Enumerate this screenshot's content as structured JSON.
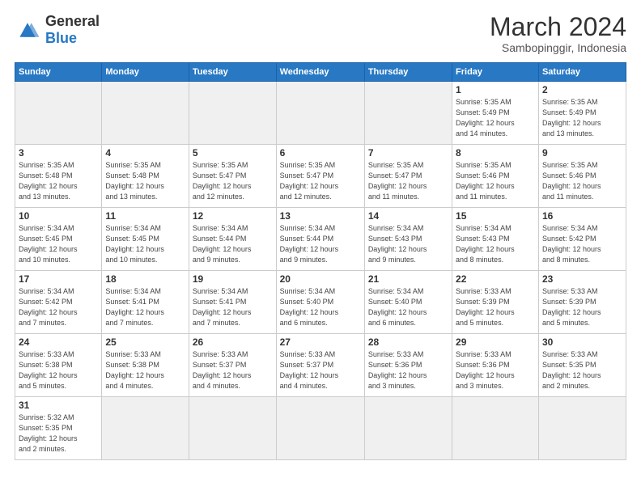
{
  "header": {
    "logo_general": "General",
    "logo_blue": "Blue",
    "month_year": "March 2024",
    "location": "Sambopinggir, Indonesia"
  },
  "weekdays": [
    "Sunday",
    "Monday",
    "Tuesday",
    "Wednesday",
    "Thursday",
    "Friday",
    "Saturday"
  ],
  "weeks": [
    [
      {
        "day": "",
        "info": ""
      },
      {
        "day": "",
        "info": ""
      },
      {
        "day": "",
        "info": ""
      },
      {
        "day": "",
        "info": ""
      },
      {
        "day": "",
        "info": ""
      },
      {
        "day": "1",
        "info": "Sunrise: 5:35 AM\nSunset: 5:49 PM\nDaylight: 12 hours\nand 14 minutes."
      },
      {
        "day": "2",
        "info": "Sunrise: 5:35 AM\nSunset: 5:49 PM\nDaylight: 12 hours\nand 13 minutes."
      }
    ],
    [
      {
        "day": "3",
        "info": "Sunrise: 5:35 AM\nSunset: 5:48 PM\nDaylight: 12 hours\nand 13 minutes."
      },
      {
        "day": "4",
        "info": "Sunrise: 5:35 AM\nSunset: 5:48 PM\nDaylight: 12 hours\nand 13 minutes."
      },
      {
        "day": "5",
        "info": "Sunrise: 5:35 AM\nSunset: 5:47 PM\nDaylight: 12 hours\nand 12 minutes."
      },
      {
        "day": "6",
        "info": "Sunrise: 5:35 AM\nSunset: 5:47 PM\nDaylight: 12 hours\nand 12 minutes."
      },
      {
        "day": "7",
        "info": "Sunrise: 5:35 AM\nSunset: 5:47 PM\nDaylight: 12 hours\nand 11 minutes."
      },
      {
        "day": "8",
        "info": "Sunrise: 5:35 AM\nSunset: 5:46 PM\nDaylight: 12 hours\nand 11 minutes."
      },
      {
        "day": "9",
        "info": "Sunrise: 5:35 AM\nSunset: 5:46 PM\nDaylight: 12 hours\nand 11 minutes."
      }
    ],
    [
      {
        "day": "10",
        "info": "Sunrise: 5:34 AM\nSunset: 5:45 PM\nDaylight: 12 hours\nand 10 minutes."
      },
      {
        "day": "11",
        "info": "Sunrise: 5:34 AM\nSunset: 5:45 PM\nDaylight: 12 hours\nand 10 minutes."
      },
      {
        "day": "12",
        "info": "Sunrise: 5:34 AM\nSunset: 5:44 PM\nDaylight: 12 hours\nand 9 minutes."
      },
      {
        "day": "13",
        "info": "Sunrise: 5:34 AM\nSunset: 5:44 PM\nDaylight: 12 hours\nand 9 minutes."
      },
      {
        "day": "14",
        "info": "Sunrise: 5:34 AM\nSunset: 5:43 PM\nDaylight: 12 hours\nand 9 minutes."
      },
      {
        "day": "15",
        "info": "Sunrise: 5:34 AM\nSunset: 5:43 PM\nDaylight: 12 hours\nand 8 minutes."
      },
      {
        "day": "16",
        "info": "Sunrise: 5:34 AM\nSunset: 5:42 PM\nDaylight: 12 hours\nand 8 minutes."
      }
    ],
    [
      {
        "day": "17",
        "info": "Sunrise: 5:34 AM\nSunset: 5:42 PM\nDaylight: 12 hours\nand 7 minutes."
      },
      {
        "day": "18",
        "info": "Sunrise: 5:34 AM\nSunset: 5:41 PM\nDaylight: 12 hours\nand 7 minutes."
      },
      {
        "day": "19",
        "info": "Sunrise: 5:34 AM\nSunset: 5:41 PM\nDaylight: 12 hours\nand 7 minutes."
      },
      {
        "day": "20",
        "info": "Sunrise: 5:34 AM\nSunset: 5:40 PM\nDaylight: 12 hours\nand 6 minutes."
      },
      {
        "day": "21",
        "info": "Sunrise: 5:34 AM\nSunset: 5:40 PM\nDaylight: 12 hours\nand 6 minutes."
      },
      {
        "day": "22",
        "info": "Sunrise: 5:33 AM\nSunset: 5:39 PM\nDaylight: 12 hours\nand 5 minutes."
      },
      {
        "day": "23",
        "info": "Sunrise: 5:33 AM\nSunset: 5:39 PM\nDaylight: 12 hours\nand 5 minutes."
      }
    ],
    [
      {
        "day": "24",
        "info": "Sunrise: 5:33 AM\nSunset: 5:38 PM\nDaylight: 12 hours\nand 5 minutes."
      },
      {
        "day": "25",
        "info": "Sunrise: 5:33 AM\nSunset: 5:38 PM\nDaylight: 12 hours\nand 4 minutes."
      },
      {
        "day": "26",
        "info": "Sunrise: 5:33 AM\nSunset: 5:37 PM\nDaylight: 12 hours\nand 4 minutes."
      },
      {
        "day": "27",
        "info": "Sunrise: 5:33 AM\nSunset: 5:37 PM\nDaylight: 12 hours\nand 4 minutes."
      },
      {
        "day": "28",
        "info": "Sunrise: 5:33 AM\nSunset: 5:36 PM\nDaylight: 12 hours\nand 3 minutes."
      },
      {
        "day": "29",
        "info": "Sunrise: 5:33 AM\nSunset: 5:36 PM\nDaylight: 12 hours\nand 3 minutes."
      },
      {
        "day": "30",
        "info": "Sunrise: 5:33 AM\nSunset: 5:35 PM\nDaylight: 12 hours\nand 2 minutes."
      }
    ],
    [
      {
        "day": "31",
        "info": "Sunrise: 5:32 AM\nSunset: 5:35 PM\nDaylight: 12 hours\nand 2 minutes."
      },
      {
        "day": "",
        "info": ""
      },
      {
        "day": "",
        "info": ""
      },
      {
        "day": "",
        "info": ""
      },
      {
        "day": "",
        "info": ""
      },
      {
        "day": "",
        "info": ""
      },
      {
        "day": "",
        "info": ""
      }
    ]
  ]
}
